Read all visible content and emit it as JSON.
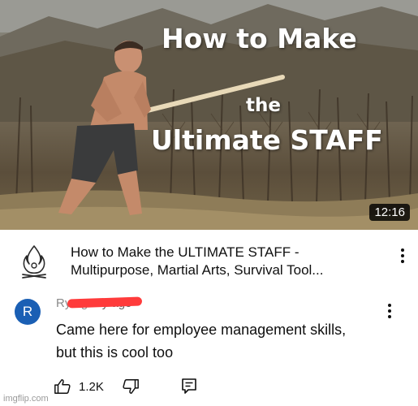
{
  "thumbnail": {
    "title_line1": "How to Make",
    "title_line2": "the",
    "title_line3": "Ultimate STAFF",
    "duration": "12:16"
  },
  "video": {
    "title_line1": "How to Make the ULTIMATE STAFF -",
    "title_line2": "Multipurpose, Martial Arts, Survival Tool...",
    "channel_logo_icon": "campfire-logo-icon",
    "menu_icon": "more-vertical-icon"
  },
  "comment": {
    "avatar_letter": "R",
    "avatar_color": "#1a5fb4",
    "author_visible": "Ry            ng",
    "age": "2y ago",
    "text_line1": "Came here for employee management skills,",
    "text_line2": "but this is cool too",
    "like_count": "1.2K",
    "icons": [
      "thumbs-up-icon",
      "thumbs-down-icon",
      "reply-icon",
      "more-vertical-icon"
    ]
  },
  "watermark": "imgflip.com"
}
